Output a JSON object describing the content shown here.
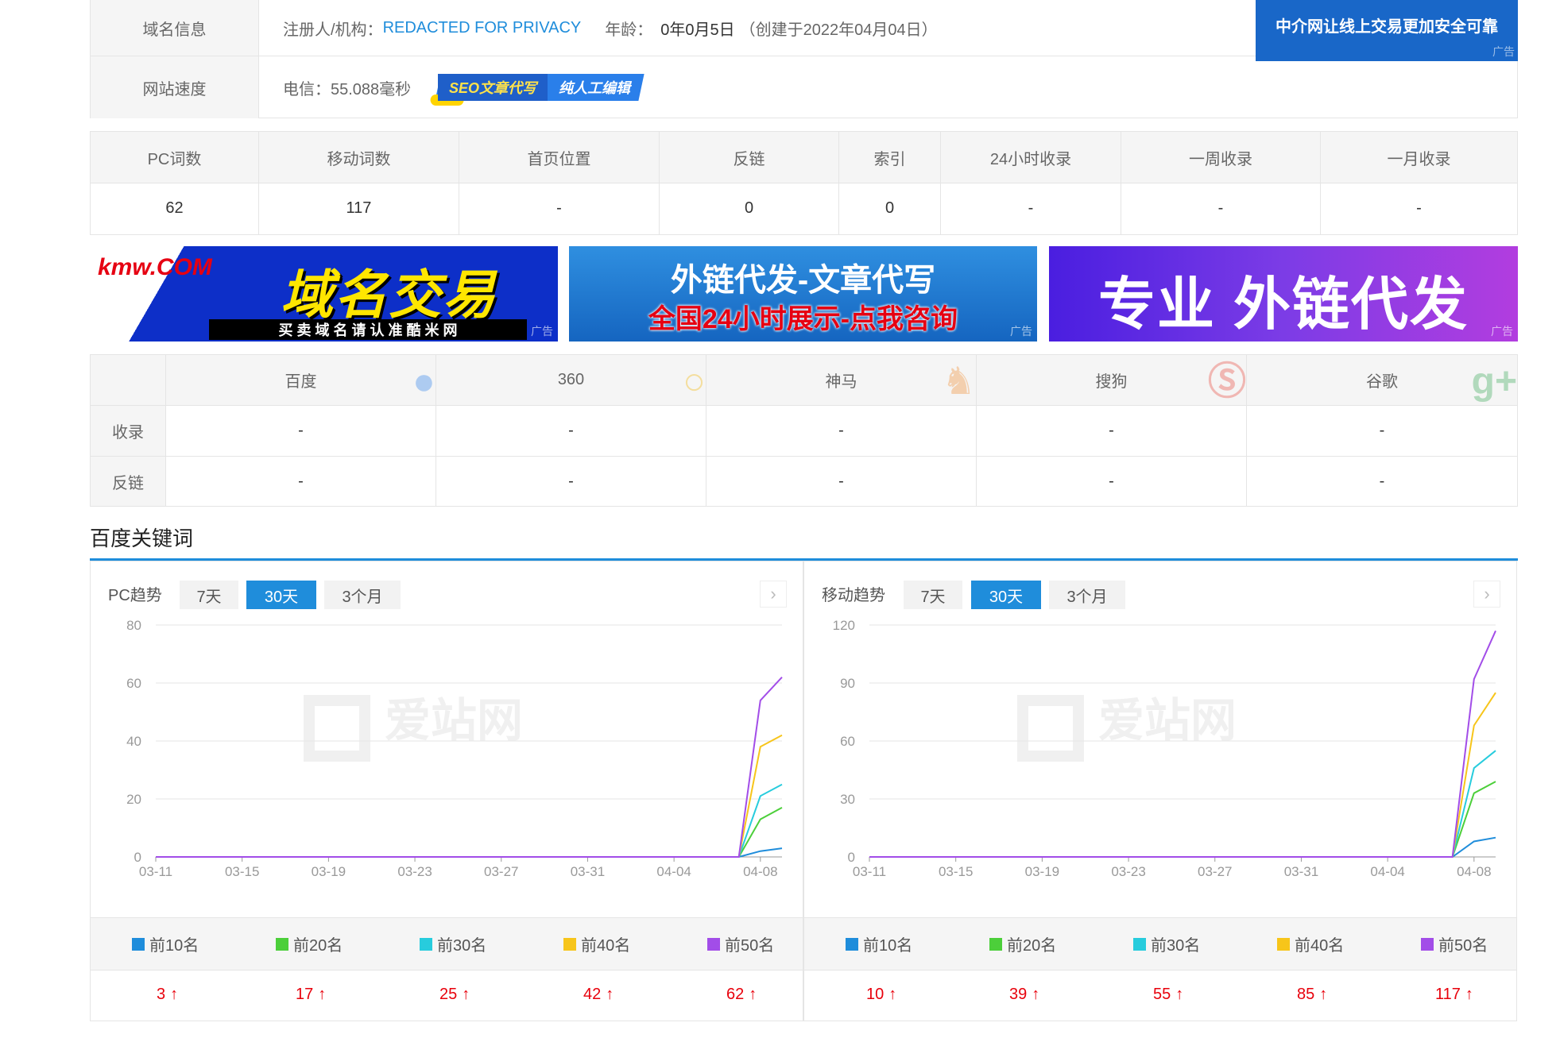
{
  "info": {
    "domain_label": "域名信息",
    "registrant_prefix": "注册人/机构：",
    "registrant_value": "REDACTED FOR PRIVACY",
    "age_prefix": "年龄：",
    "age_value": "0年0月5日",
    "age_created": "（创建于2022年04月04日）",
    "speed_label": "网站速度",
    "speed_value": "电信：55.088毫秒",
    "seo_badge_a": "SEO文章代写",
    "seo_badge_b": "纯人工编辑",
    "top_ad_text": "中介网让线上交易更加安全可靠",
    "ad_tag": "广告"
  },
  "stats": {
    "headers": [
      "PC词数",
      "移动词数",
      "首页位置",
      "反链",
      "索引",
      "24小时收录",
      "一周收录",
      "一月收录"
    ],
    "values": [
      "62",
      "117",
      "-",
      "0",
      "0",
      "-",
      "-",
      "-"
    ]
  },
  "banners": {
    "b1_logo": "kmw.COM",
    "b1_main": "域名交易",
    "b1_sub": "买 卖 域 名 请 认 准 酷 米 网",
    "b2_line1": "外链代发-文章代写",
    "b2_line2": "全国24小时展示-点我咨询",
    "b3_text": "专业 外链代发",
    "tag": "广告"
  },
  "engines": {
    "names": [
      "百度",
      "360",
      "神马",
      "搜狗",
      "谷歌"
    ],
    "icons": [
      "paw-icon",
      "magnifier-icon",
      "shenma-icon",
      "sogou-icon",
      "google-plus-icon"
    ],
    "row1_label": "收录",
    "row1_values": [
      "-",
      "-",
      "-",
      "-",
      "-"
    ],
    "row2_label": "反链",
    "row2_values": [
      "-",
      "-",
      "-",
      "-",
      "-"
    ]
  },
  "section_title": "百度关键词",
  "pc_panel": {
    "title": "PC趋势",
    "tabs": [
      "7天",
      "30天",
      "3个月"
    ],
    "active_tab": "30天",
    "legend": [
      "前10名",
      "前20名",
      "前30名",
      "前40名",
      "前50名"
    ],
    "totals": [
      "3",
      "17",
      "25",
      "42",
      "62"
    ]
  },
  "mobile_panel": {
    "title": "移动趋势",
    "tabs": [
      "7天",
      "30天",
      "3个月"
    ],
    "active_tab": "30天",
    "legend": [
      "前10名",
      "前20名",
      "前30名",
      "前40名",
      "前50名"
    ],
    "totals": [
      "10",
      "39",
      "55",
      "85",
      "117"
    ]
  },
  "watermark": "爱站网",
  "colors": {
    "top10": "#1f8ddb",
    "top20": "#4ccf3a",
    "top30": "#27ccdd",
    "top40": "#f7c51a",
    "top50": "#a24de8",
    "accent": "#1f8ddb",
    "up_arrow": "#e8000b"
  },
  "chart_data": [
    {
      "type": "line",
      "title": "PC趋势",
      "x_tick_labels": [
        "03-11",
        "03-15",
        "03-19",
        "03-23",
        "03-27",
        "03-31",
        "04-04",
        "04-08"
      ],
      "x": [
        "03-11",
        "03-12",
        "03-13",
        "03-14",
        "03-15",
        "03-16",
        "03-17",
        "03-18",
        "03-19",
        "03-20",
        "03-21",
        "03-22",
        "03-23",
        "03-24",
        "03-25",
        "03-26",
        "03-27",
        "03-28",
        "03-29",
        "03-30",
        "03-31",
        "04-01",
        "04-02",
        "04-03",
        "04-04",
        "04-05",
        "04-06",
        "04-07",
        "04-08",
        "04-09"
      ],
      "ylim": [
        0,
        80
      ],
      "yticks": [
        0,
        20,
        40,
        60,
        80
      ],
      "series": [
        {
          "name": "前10名",
          "values": [
            0,
            0,
            0,
            0,
            0,
            0,
            0,
            0,
            0,
            0,
            0,
            0,
            0,
            0,
            0,
            0,
            0,
            0,
            0,
            0,
            0,
            0,
            0,
            0,
            0,
            0,
            0,
            0,
            2,
            3
          ]
        },
        {
          "name": "前20名",
          "values": [
            0,
            0,
            0,
            0,
            0,
            0,
            0,
            0,
            0,
            0,
            0,
            0,
            0,
            0,
            0,
            0,
            0,
            0,
            0,
            0,
            0,
            0,
            0,
            0,
            0,
            0,
            0,
            0,
            13,
            17
          ]
        },
        {
          "name": "前30名",
          "values": [
            0,
            0,
            0,
            0,
            0,
            0,
            0,
            0,
            0,
            0,
            0,
            0,
            0,
            0,
            0,
            0,
            0,
            0,
            0,
            0,
            0,
            0,
            0,
            0,
            0,
            0,
            0,
            0,
            21,
            25
          ]
        },
        {
          "name": "前40名",
          "values": [
            0,
            0,
            0,
            0,
            0,
            0,
            0,
            0,
            0,
            0,
            0,
            0,
            0,
            0,
            0,
            0,
            0,
            0,
            0,
            0,
            0,
            0,
            0,
            0,
            0,
            0,
            0,
            0,
            38,
            42
          ]
        },
        {
          "name": "前50名",
          "values": [
            0,
            0,
            0,
            0,
            0,
            0,
            0,
            0,
            0,
            0,
            0,
            0,
            0,
            0,
            0,
            0,
            0,
            0,
            0,
            0,
            0,
            0,
            0,
            0,
            0,
            0,
            0,
            0,
            54,
            62
          ]
        }
      ]
    },
    {
      "type": "line",
      "title": "移动趋势",
      "x_tick_labels": [
        "03-11",
        "03-15",
        "03-19",
        "03-23",
        "03-27",
        "03-31",
        "04-04",
        "04-08"
      ],
      "x": [
        "03-11",
        "03-12",
        "03-13",
        "03-14",
        "03-15",
        "03-16",
        "03-17",
        "03-18",
        "03-19",
        "03-20",
        "03-21",
        "03-22",
        "03-23",
        "03-24",
        "03-25",
        "03-26",
        "03-27",
        "03-28",
        "03-29",
        "03-30",
        "03-31",
        "04-01",
        "04-02",
        "04-03",
        "04-04",
        "04-05",
        "04-06",
        "04-07",
        "04-08",
        "04-09"
      ],
      "ylim": [
        0,
        120
      ],
      "yticks": [
        0,
        30,
        60,
        90,
        120
      ],
      "series": [
        {
          "name": "前10名",
          "values": [
            0,
            0,
            0,
            0,
            0,
            0,
            0,
            0,
            0,
            0,
            0,
            0,
            0,
            0,
            0,
            0,
            0,
            0,
            0,
            0,
            0,
            0,
            0,
            0,
            0,
            0,
            0,
            0,
            8,
            10
          ]
        },
        {
          "name": "前20名",
          "values": [
            0,
            0,
            0,
            0,
            0,
            0,
            0,
            0,
            0,
            0,
            0,
            0,
            0,
            0,
            0,
            0,
            0,
            0,
            0,
            0,
            0,
            0,
            0,
            0,
            0,
            0,
            0,
            0,
            33,
            39
          ]
        },
        {
          "name": "前30名",
          "values": [
            0,
            0,
            0,
            0,
            0,
            0,
            0,
            0,
            0,
            0,
            0,
            0,
            0,
            0,
            0,
            0,
            0,
            0,
            0,
            0,
            0,
            0,
            0,
            0,
            0,
            0,
            0,
            0,
            46,
            55
          ]
        },
        {
          "name": "前40名",
          "values": [
            0,
            0,
            0,
            0,
            0,
            0,
            0,
            0,
            0,
            0,
            0,
            0,
            0,
            0,
            0,
            0,
            0,
            0,
            0,
            0,
            0,
            0,
            0,
            0,
            0,
            0,
            0,
            0,
            68,
            85
          ]
        },
        {
          "name": "前50名",
          "values": [
            0,
            0,
            0,
            0,
            0,
            0,
            0,
            0,
            0,
            0,
            0,
            0,
            0,
            0,
            0,
            0,
            0,
            0,
            0,
            0,
            0,
            0,
            0,
            0,
            0,
            0,
            0,
            0,
            92,
            117
          ]
        }
      ]
    }
  ]
}
